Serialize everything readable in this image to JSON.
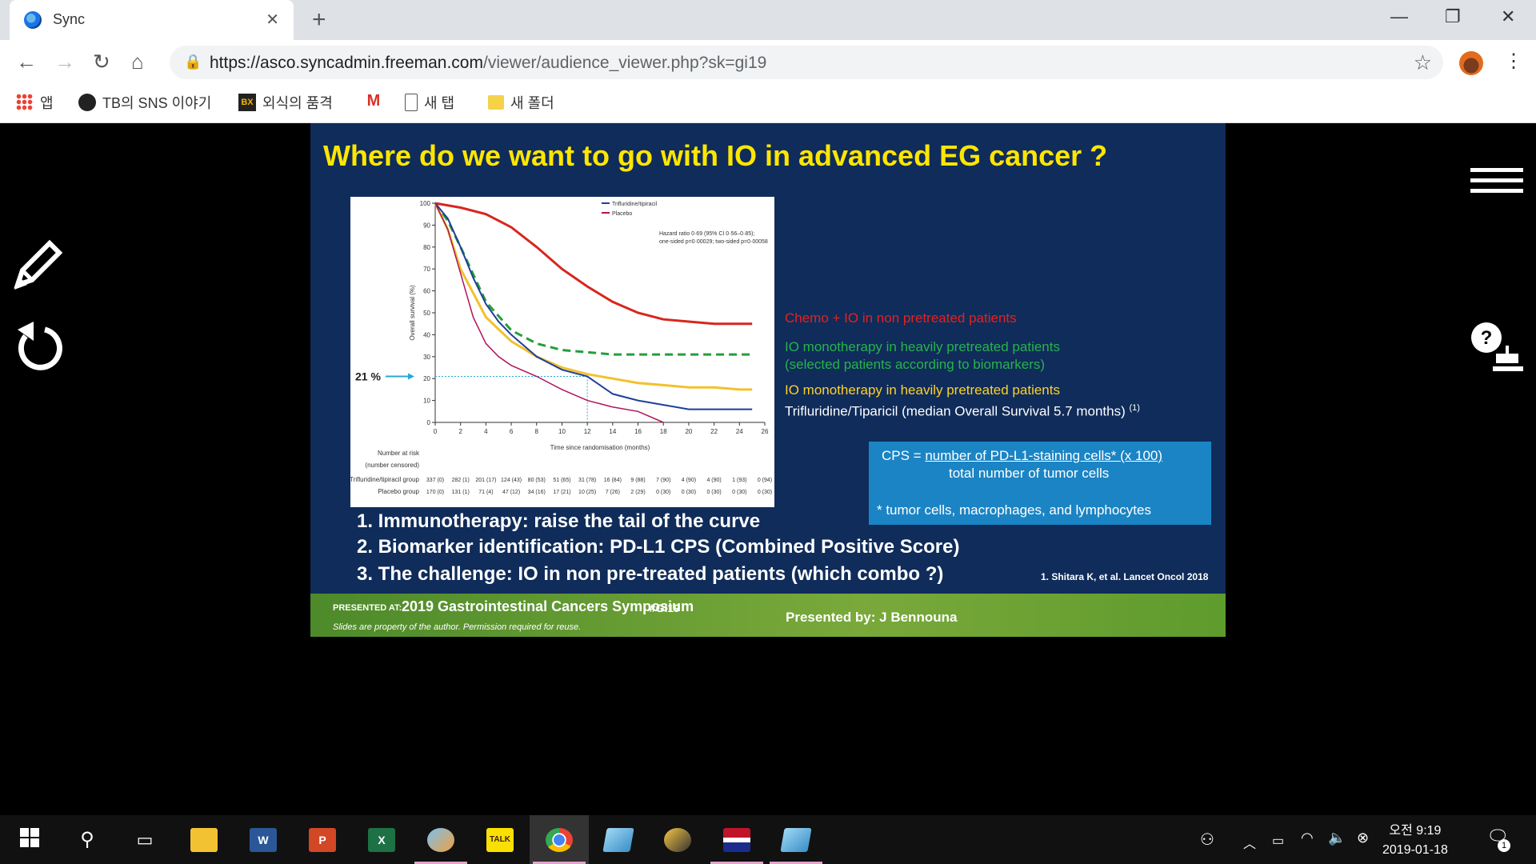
{
  "browser": {
    "tab_title": "Sync",
    "new_tab_label": "+",
    "url_host": "https://asco.syncadmin.freeman.com",
    "url_path": "/viewer/audience_viewer.php?sk=gi19"
  },
  "bookmarks": [
    {
      "label": "앱",
      "icon": "apps-grid-icon"
    },
    {
      "label": "TB의 SNS 이야기",
      "icon": "user-avatar-icon"
    },
    {
      "label": "외식의 품격",
      "icon": "bx-logo-icon"
    },
    {
      "label": "",
      "icon": "gmail-icon"
    },
    {
      "label": "새 탭",
      "icon": "page-icon"
    },
    {
      "label": "새 폴더",
      "icon": "folder-icon"
    }
  ],
  "slide": {
    "title": "Where do we want to go with IO in advanced EG cancer ?",
    "annotations": {
      "chemo_io": "Chemo + IO in non pretreated patients",
      "io_selected_1": "IO monotherapy in heavily pretreated patients",
      "io_selected_2": "(selected patients according to biomarkers)",
      "io_heavy": "IO monotherapy in heavily pretreated patients",
      "trifluridine": "Trifluridine/Tiparicil (median Overall Survival 5.7 months)",
      "trifluridine_sup": "(1)"
    },
    "cps": {
      "prefix": "CPS = ",
      "numerator": "number of PD-L1-staining cells* (x 100)",
      "denominator": "total number of tumor cells",
      "footnote": "* tumor cells, macrophages, and lymphocytes"
    },
    "points": [
      "1. Immunotherapy: raise the tail of the curve",
      "2. Biomarker identification: PD-L1 CPS (Combined Positive Score)",
      "3. The challenge: IO in non pre-treated patients (which combo ?)"
    ],
    "citation": "1. Shitara K, et al. Lancet Oncol 2018",
    "footer": {
      "presented_at": "PRESENTED AT:",
      "symposium": "2019 Gastrointestinal Cancers Symposium",
      "hashtag": "|  #GI19",
      "disclaimer": "Slides are property of the author. Permission required for reuse.",
      "presenter": "Presented by: J Bennouna"
    }
  },
  "chart_data": {
    "type": "line",
    "xlabel": "Time since randomisation (months)",
    "ylabel": "Overall survival (%)",
    "xlim": [
      0,
      26
    ],
    "ylim": [
      0,
      100
    ],
    "x_ticks": [
      0,
      2,
      4,
      6,
      8,
      10,
      12,
      14,
      16,
      18,
      20,
      22,
      24,
      26
    ],
    "y_ticks": [
      0,
      10,
      20,
      30,
      40,
      50,
      60,
      70,
      80,
      90,
      100
    ],
    "legend": [
      "Trifluridine/tipiracil",
      "Placebo"
    ],
    "hazard_text_1": "Hazard ratio 0·69 (95% CI 0·56–0·85);",
    "hazard_text_2": "one-sided p=0·00029; two-sided p=0·00058",
    "marker_label": "21 %",
    "colors": {
      "red": "#d7261e",
      "green": "#21a038",
      "yellow": "#f2c12e",
      "blue": "#1f3f99",
      "placebo": "#b0145a"
    },
    "series": [
      {
        "name": "Chemo + IO in non pretreated patients",
        "x": [
          0,
          2,
          4,
          6,
          8,
          10,
          12,
          14,
          16,
          18,
          20,
          22,
          24,
          25
        ],
        "values": [
          100,
          98,
          95,
          89,
          80,
          70,
          62,
          55,
          50,
          47,
          46,
          45,
          45,
          45
        ]
      },
      {
        "name": "IO monotherapy in heavily pretreated patients (selected patients according to biomarkers)",
        "x": [
          0,
          1,
          2,
          4,
          6,
          8,
          10,
          12,
          14,
          16,
          18,
          20,
          22,
          24,
          25
        ],
        "values": [
          100,
          92,
          80,
          55,
          42,
          36,
          33,
          32,
          31,
          31,
          31,
          31,
          31,
          31,
          31
        ]
      },
      {
        "name": "IO monotherapy in heavily pretreated patients",
        "x": [
          0,
          1,
          2,
          4,
          6,
          8,
          10,
          12,
          14,
          16,
          18,
          20,
          22,
          24,
          25
        ],
        "values": [
          100,
          88,
          70,
          48,
          37,
          30,
          25,
          22,
          20,
          18,
          17,
          16,
          16,
          15,
          15
        ]
      },
      {
        "name": "Trifluridine/tipiracil",
        "x": [
          0,
          1,
          2,
          3,
          4,
          5,
          6,
          8,
          10,
          12,
          14,
          16,
          18,
          20,
          22,
          24,
          25
        ],
        "values": [
          100,
          93,
          80,
          66,
          54,
          46,
          40,
          30,
          24,
          21,
          13,
          10,
          8,
          6,
          6,
          6,
          6
        ]
      },
      {
        "name": "Placebo",
        "x": [
          0,
          1,
          2,
          3,
          4,
          5,
          6,
          8,
          10,
          12,
          14,
          16,
          18
        ],
        "values": [
          100,
          88,
          68,
          48,
          36,
          30,
          26,
          21,
          15,
          10,
          7,
          5,
          0
        ]
      }
    ],
    "risk_table": {
      "title": "Number at risk",
      "subtitle": "(number censored)",
      "rows": [
        {
          "label": "Trifluridine/tipiracil group",
          "values": [
            "337 (0)",
            "282 (1)",
            "201 (17)",
            "124 (43)",
            "80 (53)",
            "51 (65)",
            "31 (78)",
            "16 (84)",
            "9 (88)",
            "7 (90)",
            "4 (90)",
            "4 (90)",
            "1 (93)",
            "0 (94)"
          ]
        },
        {
          "label": "Placebo group",
          "values": [
            "170 (0)",
            "131 (1)",
            "71 (4)",
            "47 (12)",
            "34 (16)",
            "17 (21)",
            "10 (25)",
            "7 (26)",
            "2 (29)",
            "0 (30)",
            "0 (30)",
            "0 (30)",
            "0 (30)",
            "0 (30)"
          ]
        }
      ]
    }
  },
  "taskbar": {
    "items": [
      "windows-start-icon",
      "search-icon",
      "task-view-icon",
      "file-explorer-icon",
      "word-icon",
      "powerpoint-icon",
      "excel-icon",
      "paint-icon",
      "kakaotalk-icon",
      "chrome-icon",
      "app-icon",
      "app2-icon",
      "floppy-icon",
      "app3-icon"
    ],
    "word_label": "W",
    "ppt_label": "P",
    "excel_label": "X",
    "talk_label": "TALK",
    "time": "오전 9:19",
    "date": "2019-01-18",
    "notif_count": "1"
  }
}
